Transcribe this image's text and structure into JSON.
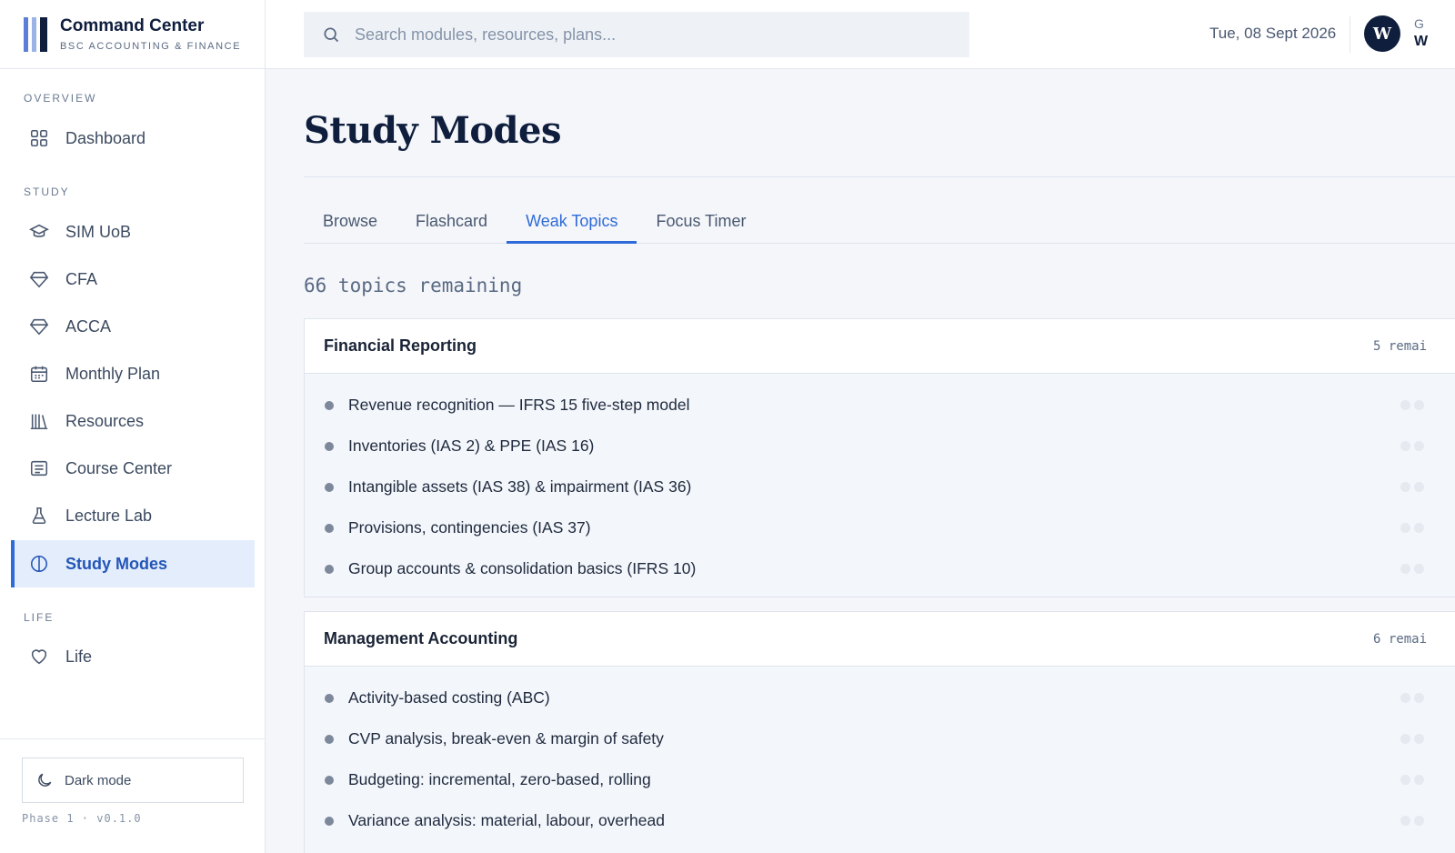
{
  "brand": {
    "title": "Command Center",
    "subtitle": "BSC ACCOUNTING & FINANCE"
  },
  "sidebar": {
    "sections": [
      {
        "label": "OVERVIEW"
      },
      {
        "label": "STUDY"
      },
      {
        "label": "LIFE"
      }
    ],
    "items": [
      {
        "label": "Dashboard",
        "icon": "grid-icon"
      },
      {
        "label": "SIM UoB",
        "icon": "graduation-cap-icon"
      },
      {
        "label": "CFA",
        "icon": "diamond-icon"
      },
      {
        "label": "ACCA",
        "icon": "diamond-icon"
      },
      {
        "label": "Monthly Plan",
        "icon": "calendar-icon"
      },
      {
        "label": "Resources",
        "icon": "library-icon"
      },
      {
        "label": "Course Center",
        "icon": "document-icon"
      },
      {
        "label": "Lecture Lab",
        "icon": "flask-icon"
      },
      {
        "label": "Study Modes",
        "icon": "half-circle-icon",
        "active": true
      },
      {
        "label": "Life",
        "icon": "heart-icon"
      }
    ],
    "dark_mode_label": "Dark mode",
    "version": "Phase 1 · v0.1.0"
  },
  "header": {
    "search_placeholder": "Search modules, resources, plans...",
    "date": "Tue, 08 Sept 2026",
    "avatar_initial": "W",
    "greeting": "G",
    "user_name": "W"
  },
  "main": {
    "title": "Study Modes",
    "tabs": [
      {
        "label": "Browse"
      },
      {
        "label": "Flashcard"
      },
      {
        "label": "Weak Topics",
        "active": true
      },
      {
        "label": "Focus Timer"
      }
    ],
    "remaining": "66 topics remaining",
    "groups": [
      {
        "title": "Financial Reporting",
        "count": "5 remai",
        "topics": [
          "Revenue recognition — IFRS 15 five-step model",
          "Inventories (IAS 2) & PPE (IAS 16)",
          "Intangible assets (IAS 38) & impairment (IAS 36)",
          "Provisions, contingencies (IAS 37)",
          "Group accounts & consolidation basics (IFRS 10)"
        ]
      },
      {
        "title": "Management Accounting",
        "count": "6 remai",
        "topics": [
          "Activity-based costing (ABC)",
          "CVP analysis, break-even & margin of safety",
          "Budgeting: incremental, zero-based, rolling",
          "Variance analysis: material, labour, overhead"
        ]
      }
    ]
  },
  "colors": {
    "accent": "#2f6bd8",
    "navy": "#0f1e3d",
    "active_bg": "#e3edfb"
  }
}
